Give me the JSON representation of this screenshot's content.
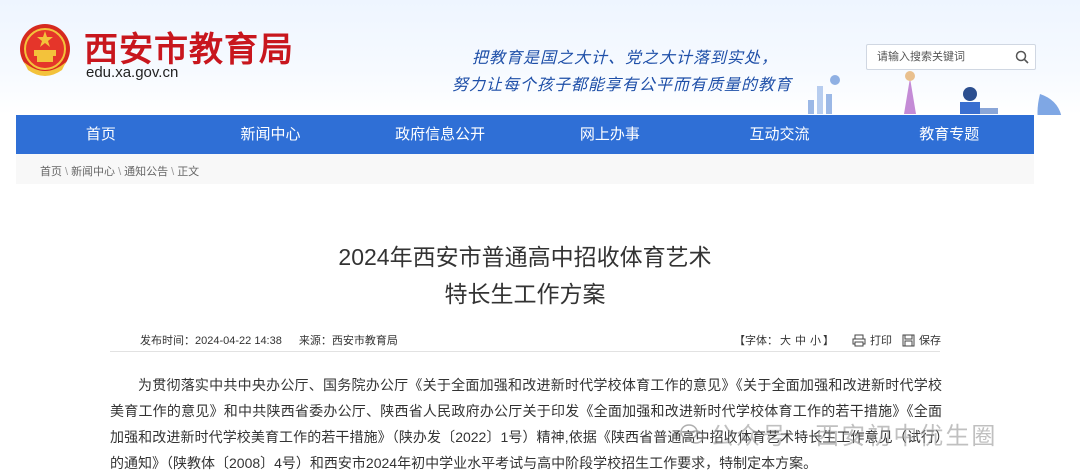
{
  "header": {
    "site_name": "西安市教育局",
    "site_domain": "edu.xa.gov.cn",
    "slogan_line1": "把教育是国之大计、党之大计落到实处，",
    "slogan_line2": "努力让每个孩子都能享有公平而有质量的教育",
    "search_placeholder": "请输入搜索关键词"
  },
  "nav": {
    "items": [
      {
        "label": "首页"
      },
      {
        "label": "新闻中心"
      },
      {
        "label": "政府信息公开"
      },
      {
        "label": "网上办事"
      },
      {
        "label": "互动交流"
      },
      {
        "label": "教育专题"
      }
    ]
  },
  "breadcrumb": {
    "items": [
      "首页",
      "新闻中心",
      "通知公告",
      "正文"
    ],
    "separator": "\\"
  },
  "article": {
    "title_line1": "2024年西安市普通高中招收体育艺术",
    "title_line2": "特长生工作方案",
    "publish_time": "发布时间：2024-04-22 14:38",
    "source": "来源：西安市教育局",
    "font_size_label": "【字体：",
    "font_large": "大",
    "font_medium": "中",
    "font_small": "小",
    "font_size_end": "】",
    "print_label": "打印",
    "save_label": "保存",
    "body": "为贯彻落实中共中央办公厅、国务院办公厅《关于全面加强和改进新时代学校体育工作的意见》《关于全面加强和改进新时代学校美育工作的意见》和中共陕西省委办公厅、陕西省人民政府办公厅关于印发《全面加强和改进新时代学校体育工作的若干措施》《全面加强和改进新时代学校美育工作的若干措施》（陕办发〔2022〕1号）精神,依据《陕西省普通高中招收体育艺术特长生工作意见（试行）的通知》（陕教体〔2008〕4号）和西安市2024年初中学业水平考试与高中阶段学校招生工作要求，特制定本方案。"
  },
  "watermark": {
    "text": "公众号 · 西安初中优生圈"
  },
  "colors": {
    "brand_red": "#c8161d",
    "nav_blue": "#2f6fd6",
    "slogan_blue": "#1e4fa8"
  }
}
